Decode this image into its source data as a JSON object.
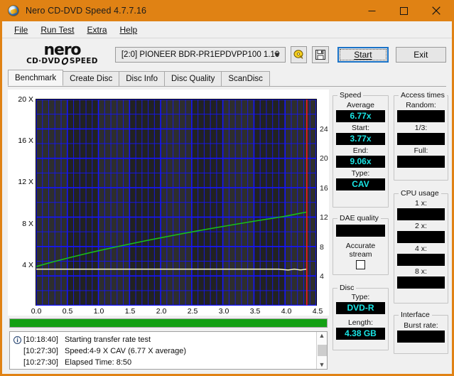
{
  "window": {
    "title": "Nero CD-DVD Speed 4.7.7.16",
    "icon": "nero-disc-icon",
    "minimize_label": "–",
    "maximize_label": "□",
    "close_label": "✕"
  },
  "menu": [
    {
      "label": "File",
      "mnemonic": "F"
    },
    {
      "label": "Run Test",
      "mnemonic": "R"
    },
    {
      "label": "Extra",
      "mnemonic": "E"
    },
    {
      "label": "Help",
      "mnemonic": "H"
    }
  ],
  "logo": {
    "name": "nero",
    "sub_left": "CD·DVD",
    "sub_right": "SPEED"
  },
  "toolbar": {
    "drive": "[2:0]   PIONEER BDR-PR1EPDVPP100 1.10",
    "eject_icon": "disc-eject-icon",
    "save_icon": "floppy-save-icon",
    "start_label": "Start",
    "exit_label": "Exit"
  },
  "tabs": [
    {
      "label": "Benchmark",
      "active": true
    },
    {
      "label": "Create Disc",
      "active": false
    },
    {
      "label": "Disc Info",
      "active": false
    },
    {
      "label": "Disc Quality",
      "active": false
    },
    {
      "label": "ScanDisc",
      "active": false
    }
  ],
  "chart_data": {
    "type": "line",
    "title": "",
    "xlabel": "",
    "ylabel": "",
    "xlim": [
      0.0,
      4.5
    ],
    "ylim": [
      0,
      20
    ],
    "y2lim": [
      0,
      28
    ],
    "grid": true,
    "legend": "none",
    "xticks": [
      "0.0",
      "0.5",
      "1.0",
      "1.5",
      "2.0",
      "2.5",
      "3.0",
      "3.5",
      "4.0",
      "4.5"
    ],
    "yticks": [
      "20 X",
      "16 X",
      "12 X",
      "8 X",
      "4 X"
    ],
    "y2ticks": [
      "24",
      "20",
      "16",
      "12",
      "8",
      "4"
    ],
    "marker_line": {
      "x": 4.35,
      "color": "#ff1a1a"
    },
    "series": [
      {
        "name": "Transfer rate",
        "color": "#18c018",
        "axis": "left",
        "x": [
          0.0,
          0.25,
          0.5,
          0.75,
          1.0,
          1.25,
          1.5,
          1.75,
          2.0,
          2.25,
          2.5,
          2.75,
          3.0,
          3.25,
          3.5,
          3.75,
          4.0,
          4.25,
          4.35
        ],
        "y": [
          3.77,
          4.19,
          4.58,
          4.95,
          5.3,
          5.63,
          5.95,
          6.26,
          6.56,
          6.85,
          7.13,
          7.4,
          7.66,
          7.92,
          8.17,
          8.41,
          8.65,
          8.95,
          9.06
        ]
      },
      {
        "name": "Access / CPU trace",
        "color": "#f2f2c0",
        "axis": "right",
        "x": [
          0.0,
          0.5,
          1.0,
          1.5,
          2.0,
          2.5,
          3.0,
          3.5,
          3.9,
          4.05,
          4.15,
          4.25,
          4.35
        ],
        "y": [
          4.92,
          4.92,
          4.92,
          4.92,
          4.92,
          4.92,
          4.92,
          4.92,
          4.92,
          4.8,
          4.92,
          4.8,
          4.92
        ]
      }
    ]
  },
  "progress": {
    "percent": 100
  },
  "log": {
    "info_icon": "info-icon",
    "rows": [
      {
        "icon": "info-icon",
        "time": "[10:18:40]",
        "text": "Starting transfer rate test"
      },
      {
        "icon": "",
        "time": "[10:27:30]",
        "text": "Speed:4-9 X CAV (6.77 X average)"
      },
      {
        "icon": "",
        "time": "[10:27:30]",
        "text": "Elapsed Time:  8:50"
      }
    ],
    "scroll_up": "▲",
    "scroll_down": "▼"
  },
  "panels": {
    "speed": {
      "legend": "Speed",
      "fields": [
        {
          "label": "Average",
          "value": "6.77x"
        },
        {
          "label": "Start:",
          "value": "3.77x"
        },
        {
          "label": "End:",
          "value": "9.06x"
        },
        {
          "label": "Type:",
          "value": "CAV"
        }
      ]
    },
    "dae": {
      "legend": "DAE quality",
      "value": "",
      "checkbox_label_line1": "Accurate",
      "checkbox_label_line2": "stream",
      "checkbox_checked": false
    },
    "disc": {
      "legend": "Disc",
      "fields": [
        {
          "label": "Type:",
          "value": "DVD-R"
        },
        {
          "label": "Length:",
          "value": "4.38 GB"
        }
      ]
    },
    "access": {
      "legend": "Access times",
      "fields": [
        {
          "label": "Random:",
          "value": ""
        },
        {
          "label": "1/3:",
          "value": ""
        },
        {
          "label": "Full:",
          "value": ""
        }
      ]
    },
    "cpu": {
      "legend": "CPU usage",
      "fields": [
        {
          "label": "1 x:",
          "value": ""
        },
        {
          "label": "2 x:",
          "value": ""
        },
        {
          "label": "4 x:",
          "value": ""
        },
        {
          "label": "8 x:",
          "value": ""
        }
      ]
    },
    "interface": {
      "legend": "Interface",
      "fields": [
        {
          "label": "Burst rate:",
          "value": ""
        }
      ]
    }
  },
  "colors": {
    "accent": "#e08214",
    "lcd_text": "#19e6e6",
    "lcd_bg": "#000000",
    "progress": "#13a013",
    "curve": "#18c018",
    "grid": "#1414ff",
    "marker": "#ff1a1a"
  }
}
